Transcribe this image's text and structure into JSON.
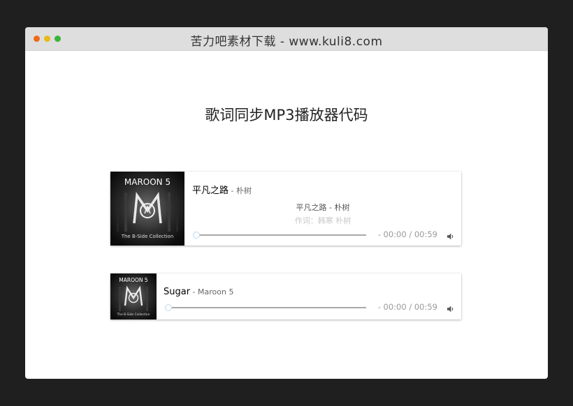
{
  "window": {
    "title": "苦力吧素材下载 - www.kuli8.com"
  },
  "page": {
    "heading": "歌词同步MP3播放器代码"
  },
  "players": [
    {
      "title": "平凡之路",
      "separator": " - ",
      "artist": "朴树",
      "album_cover_text": {
        "band": "MAROON 5",
        "subtitle": "The B-Side Collection"
      },
      "lyrics": {
        "current": "平凡之路 - 朴树",
        "next": "作词：韩寒 朴树"
      },
      "time": "- 00:00 / 00:59",
      "progress_fraction": 0,
      "icons": {
        "volume": "volume-icon"
      }
    },
    {
      "title": "Sugar",
      "separator": " - ",
      "artist": "Maroon 5",
      "album_cover_text": {
        "band": "MAROON 5",
        "subtitle": "The B-Side Collection"
      },
      "time": "- 00:00 / 00:59",
      "progress_fraction": 0,
      "icons": {
        "volume": "volume-icon"
      }
    }
  ],
  "colors": {
    "traffic_close": "#ee6a1b",
    "traffic_minimize": "#e8b918",
    "traffic_maximize": "#3bb43c",
    "progress_track": "#a9a9a9",
    "progress_thumb_border": "#bcd8f2"
  }
}
